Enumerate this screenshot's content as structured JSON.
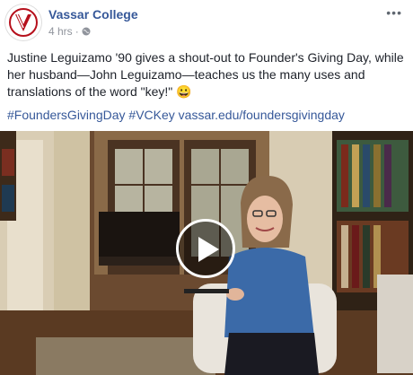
{
  "post": {
    "page_name": "Vassar College",
    "timestamp": "4 hrs",
    "privacy_icon": "globe-icon",
    "more_label": "•••",
    "text": "Justine Leguizamo '90 gives a shout-out to Founder's Giving Day, while her husband—John Leguizamo—teaches us the many uses and translations of the word \"key!\" 😀",
    "hashtags": [
      "#FoundersGivingDay",
      "#VCKey"
    ],
    "link": "vassar.edu/foundersgivingday"
  },
  "video": {
    "play_icon": "play-icon"
  },
  "colors": {
    "link": "#365899",
    "brand": "#b6101c"
  }
}
